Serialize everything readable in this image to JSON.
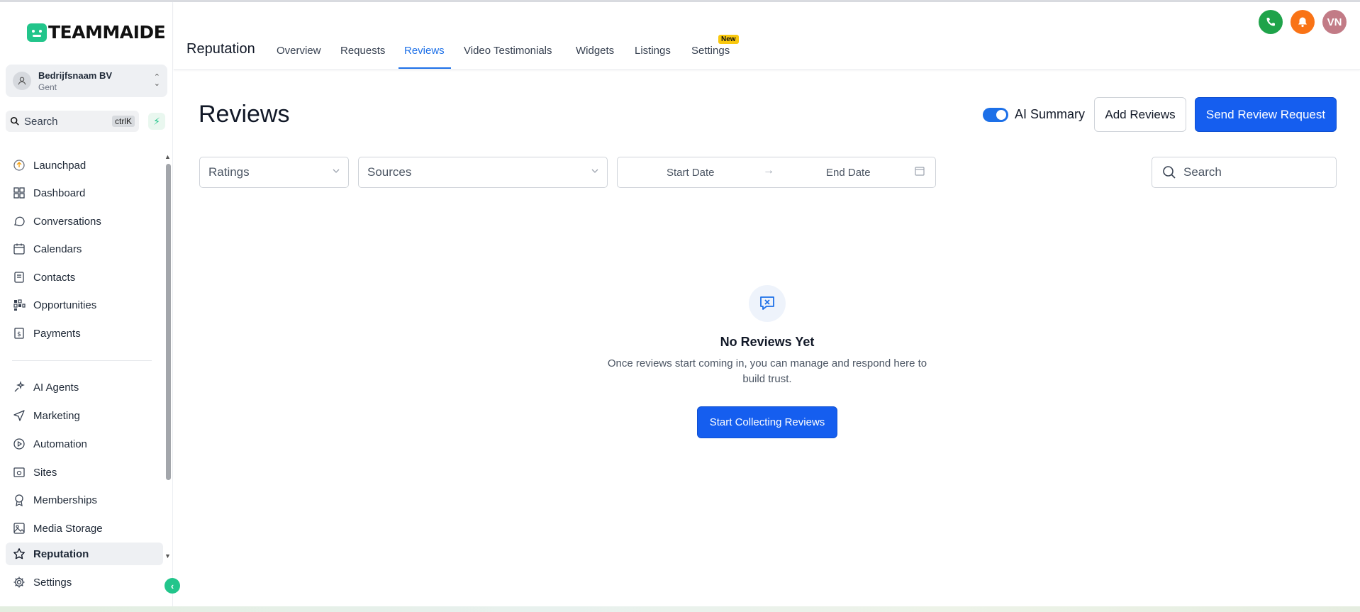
{
  "brand": {
    "logo_text": "TEAMMAIDE"
  },
  "org": {
    "name": "Bedrijfsnaam BV",
    "location": "Gent"
  },
  "sidebar_search": {
    "label": "Search",
    "shortcut": "ctrlK"
  },
  "sidebar": {
    "items": [
      {
        "label": "Launchpad",
        "icon": "rocket-icon"
      },
      {
        "label": "Dashboard",
        "icon": "grid-icon"
      },
      {
        "label": "Conversations",
        "icon": "chat-icon"
      },
      {
        "label": "Calendars",
        "icon": "calendar-icon"
      },
      {
        "label": "Contacts",
        "icon": "contact-book-icon"
      },
      {
        "label": "Opportunities",
        "icon": "pipeline-icon"
      },
      {
        "label": "Payments",
        "icon": "invoice-icon"
      },
      {
        "label": "AI Agents",
        "icon": "sparkle-icon"
      },
      {
        "label": "Marketing",
        "icon": "send-icon"
      },
      {
        "label": "Automation",
        "icon": "play-circle-icon"
      },
      {
        "label": "Sites",
        "icon": "globe-window-icon"
      },
      {
        "label": "Memberships",
        "icon": "award-icon"
      },
      {
        "label": "Media Storage",
        "icon": "image-icon"
      },
      {
        "label": "Reputation",
        "icon": "star-icon",
        "active": true
      },
      {
        "label": "Settings",
        "icon": "gear-icon"
      }
    ]
  },
  "header": {
    "module_title": "Reputation",
    "tabs": [
      {
        "label": "Overview"
      },
      {
        "label": "Requests"
      },
      {
        "label": "Reviews",
        "active": true
      },
      {
        "label": "Video Testimonials",
        "badge": "New"
      },
      {
        "label": "Widgets"
      },
      {
        "label": "Listings"
      },
      {
        "label": "Settings"
      }
    ],
    "user_initials": "VN"
  },
  "main": {
    "title": "Reviews",
    "ai_summary_label": "AI Summary",
    "ai_summary_enabled": true,
    "add_reviews_label": "Add Reviews",
    "send_request_label": "Send Review Request",
    "filters": {
      "ratings_placeholder": "Ratings",
      "sources_placeholder": "Sources",
      "start_date_placeholder": "Start Date",
      "end_date_placeholder": "End Date",
      "search_placeholder": "Search"
    },
    "empty": {
      "title": "No Reviews Yet",
      "description": "Once reviews start coming in, you can manage and respond here to build trust.",
      "cta_label": "Start Collecting Reviews"
    }
  },
  "colors": {
    "accent": "#155eef",
    "brand_green": "#22c58b",
    "phone_green": "#1fa34a",
    "bell_orange": "#f97316",
    "avatar_rose": "#c27b86"
  }
}
